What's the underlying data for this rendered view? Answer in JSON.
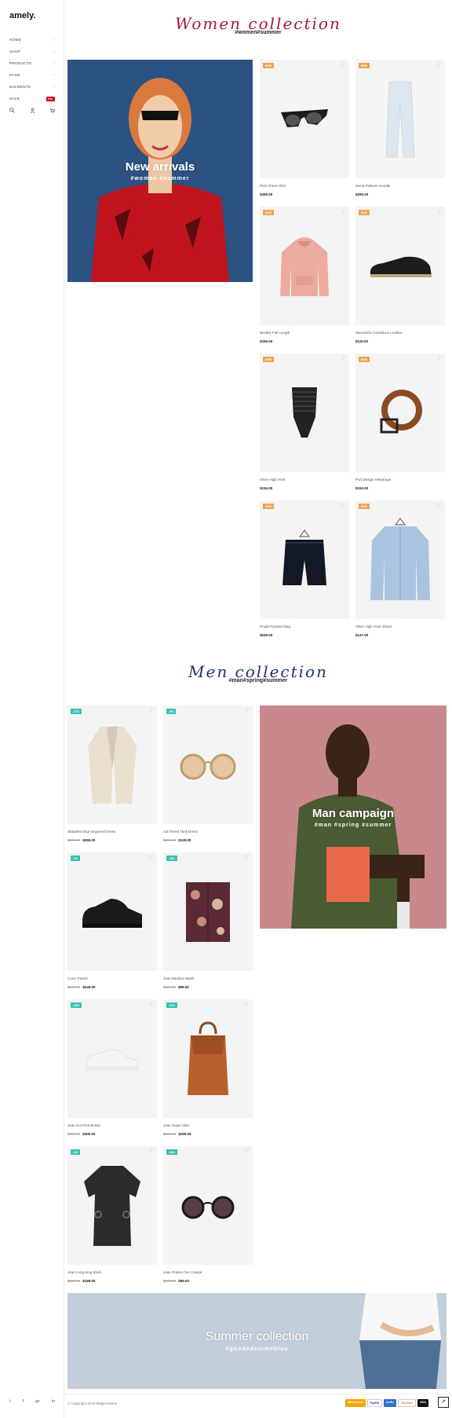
{
  "sidebar": {
    "logo": "amely.",
    "nav": [
      {
        "label": "HOME"
      },
      {
        "label": "SHOP"
      },
      {
        "label": "PRODUCTS"
      },
      {
        "label": "PAGE"
      },
      {
        "label": "ELEMENTS"
      },
      {
        "label": "SALE",
        "badge": "Hot"
      }
    ],
    "icons": [
      "search-icon",
      "user-icon",
      "cart-icon"
    ],
    "socials": [
      "twitter-icon",
      "facebook-icon",
      "google-plus-icon",
      "linkedin-icon"
    ]
  },
  "women": {
    "title": "Women collection",
    "hashtags": "#women#summer",
    "banner_title": "New arrivals",
    "banner_tags": "#woman #summer",
    "products": [
      {
        "name": "Pink Check Shirt",
        "price": "$369.00",
        "badge": "NEW"
      },
      {
        "name": "Mona Pullover Hoodie",
        "price": "$255.00",
        "badge": "NEW"
      },
      {
        "name": "Bestley Full Length",
        "price": "$255.00",
        "badge": "NEW"
      },
      {
        "name": "Samantha Colorblock Leather",
        "price": "$115.00",
        "badge": "NEW"
      },
      {
        "name": "Silver High Heel",
        "price": "$154.00",
        "badge": "NEW"
      },
      {
        "name": "Port Design Heliotrope",
        "price": "$153.00",
        "badge": "NEW"
      },
      {
        "name": "Prada Pyramid Bag",
        "price": "$549.00",
        "badge": "NEW"
      },
      {
        "name": "Silver High Heel Shoes",
        "price": "$147.00",
        "badge": "NEW"
      }
    ]
  },
  "men": {
    "title": "Men collection",
    "hashtags": "#man#spring#summer",
    "banner_title": "Man campaign",
    "banner_tags": "#man #spring #summer",
    "products": [
      {
        "name": "Strapless Digi Sequined Dress",
        "old": "$300.00",
        "price": "$269.00",
        "badge": "-27%"
      },
      {
        "name": "Adi Tiered Tank Dress",
        "old": "$157.00",
        "price": "$129.00",
        "badge": "-9%"
      },
      {
        "name": "Cona Trainer",
        "old": "$270.00",
        "price": "$245.00",
        "badge": "-9%"
      },
      {
        "name": "Jean Medium Wash",
        "old": "$114.00",
        "price": "$99.00",
        "badge": "-18%"
      },
      {
        "name": "Jean Hot Pink Brown",
        "old": "$370.00",
        "price": "$300.00",
        "badge": "-20%"
      },
      {
        "name": "Jean Super Man",
        "old": "$360.00",
        "price": "$299.00",
        "badge": "-11%"
      },
      {
        "name": "Jean Long King Black",
        "old": "$220.00",
        "price": "$199.00",
        "badge": "-9%"
      },
      {
        "name": "Jean Prairie One Casual",
        "old": "$109.00",
        "price": "$99.00",
        "badge": "-18%"
      }
    ]
  },
  "summer": {
    "title": "Summer collection",
    "tags": "#good#denim#blue"
  },
  "footer": {
    "copyright": "© Copyright 2019 Magezolution",
    "payments": [
      "MasterCard",
      "PayPal",
      "AmEx",
      "Discover",
      "VISA"
    ]
  },
  "colors": {
    "women_title": "#a01b3a",
    "men_title": "#26336b",
    "women_badge": "#f0a24e",
    "men_badge": "#3cc1b5",
    "sale_badge": "#d0021b"
  }
}
